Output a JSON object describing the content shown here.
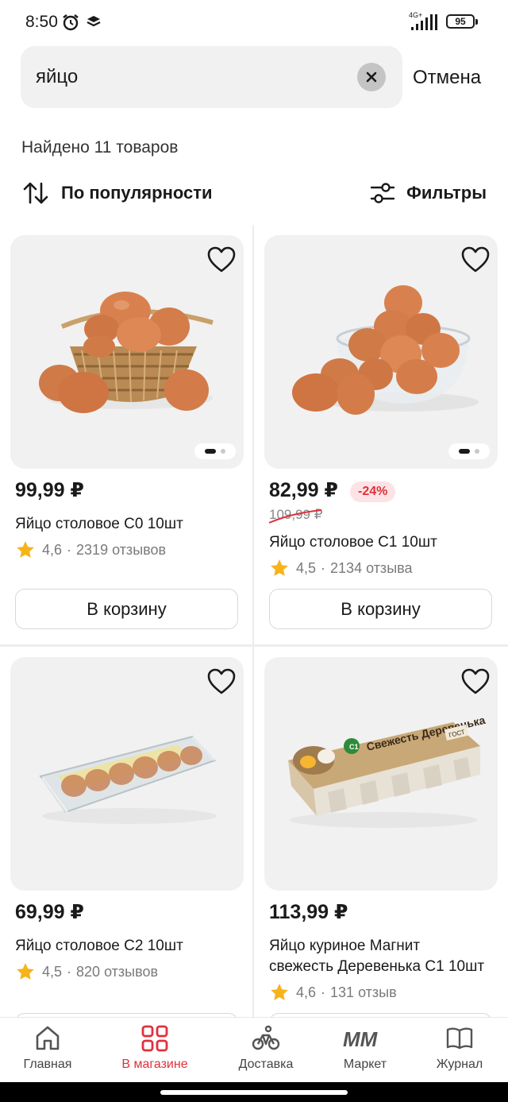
{
  "status": {
    "time": "8:50",
    "network": "4G+",
    "battery": "95"
  },
  "search": {
    "query": "яйцо",
    "cancel_label": "Отмена"
  },
  "results": {
    "found_text": "Найдено 11 товаров"
  },
  "sort": {
    "label": "По популярности"
  },
  "filters": {
    "label": "Фильтры"
  },
  "products": [
    {
      "price": "99,99 ₽",
      "title": "Яйцо столовое С0 10шт",
      "rating": "4,6",
      "reviews": "2319 отзывов",
      "cart_label": "В корзину"
    },
    {
      "price": "82,99 ₽",
      "discount": "-24%",
      "old_price": "109,99 ₽",
      "title": "Яйцо столовое С1 10шт",
      "rating": "4,5",
      "reviews": "2134 отзыва",
      "cart_label": "В корзину"
    },
    {
      "price": "69,99 ₽",
      "title": "Яйцо столовое С2 10шт",
      "rating": "4,5",
      "reviews": "820 отзывов"
    },
    {
      "price": "113,99 ₽",
      "title_line1": "Яйцо куриное Магнит",
      "title_line2": "свежесть Деревенька С1 10шт",
      "rating": "4,6",
      "reviews": "131 отзыв",
      "package_brand_text": "Свежесть Деревенька",
      "package_gost": "ГОСТ",
      "package_grade": "C1"
    }
  ],
  "rating_separator": "·",
  "bottom_nav": [
    {
      "label": "Главная",
      "icon": "home-icon"
    },
    {
      "label": "В магазине",
      "icon": "grid-icon",
      "active": true
    },
    {
      "label": "Доставка",
      "icon": "bike-icon"
    },
    {
      "label": "Маркет",
      "icon": "mm-logo-icon",
      "logo_text": "ММ"
    },
    {
      "label": "Журнал",
      "icon": "book-icon"
    }
  ],
  "colors": {
    "accent": "#e0303d",
    "star": "#f6b41a",
    "card_bg": "#f1f1f1"
  }
}
